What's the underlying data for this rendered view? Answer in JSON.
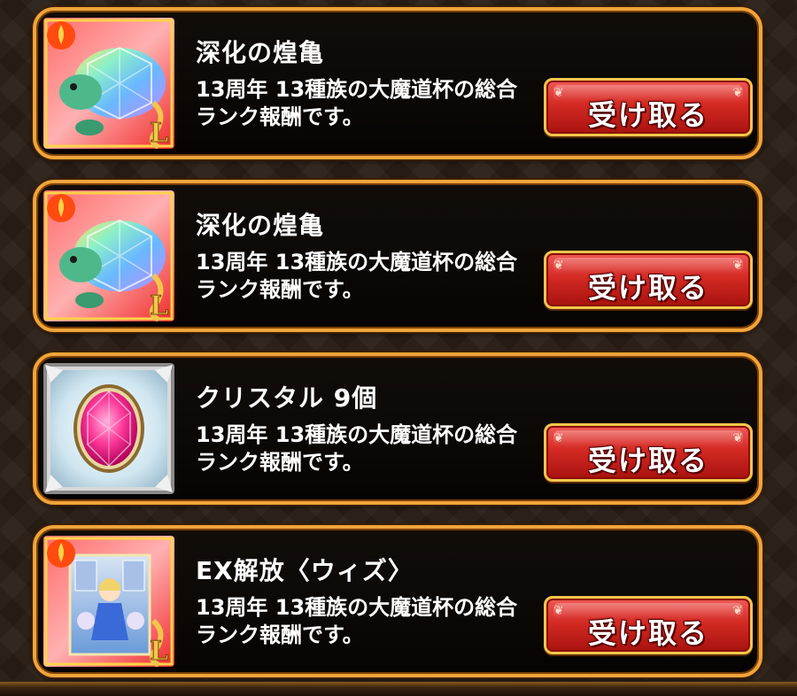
{
  "rewards": [
    {
      "title": "深化の煌亀",
      "desc_line1": "13周年 13種族の大魔道杯の総合",
      "desc_line2": "ランク報酬です。",
      "button_label": "受け取る",
      "icon": "rainbow-turtle-card-icon"
    },
    {
      "title": "深化の煌亀",
      "desc_line1": "13周年 13種族の大魔道杯の総合",
      "desc_line2": "ランク報酬です。",
      "button_label": "受け取る",
      "icon": "rainbow-turtle-card-icon"
    },
    {
      "title": "クリスタル 9個",
      "desc_line1": "13周年 13種族の大魔道杯の総合",
      "desc_line2": "ランク報酬です。",
      "button_label": "受け取る",
      "icon": "pink-crystal-icon"
    },
    {
      "title": "EX解放〈ウィズ〉",
      "desc_line1": "13周年 13種族の大魔道杯の総合",
      "desc_line2": "ランク報酬です。",
      "button_label": "受け取る",
      "icon": "wiz-ex-card-icon"
    }
  ],
  "colors": {
    "frame_gold": "#f0a43a",
    "card_bg": "#0a0705",
    "button_red": "#d42a24",
    "button_border": "#f2c64c"
  }
}
